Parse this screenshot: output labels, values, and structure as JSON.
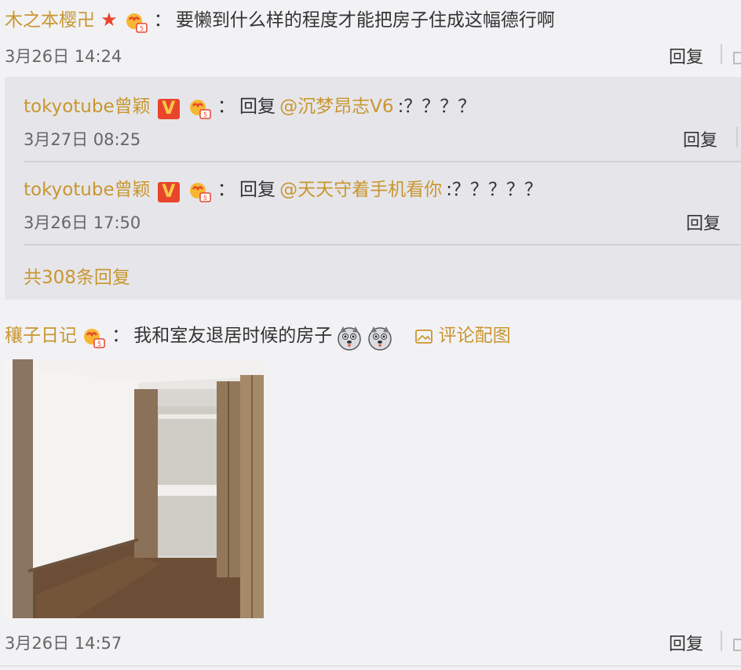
{
  "comment1": {
    "username": "木之本樱卍",
    "separator": "：",
    "text": "要懒到什么样的程度才能把房子住成这幅德行啊",
    "time": "3月26日 14:24",
    "reply_label": "回复"
  },
  "subreplies": [
    {
      "username": "tokyotube曾颖",
      "separator": "：",
      "prefix": "回复",
      "mention": "@沉梦昂志V6",
      "text": ":？？？？",
      "time": "3月27日 08:25",
      "reply_label": "回复"
    },
    {
      "username": "tokyotube曾颖",
      "separator": "：",
      "prefix": "回复",
      "mention": "@天天守着手机看你",
      "text": ":？？？？？",
      "time": "3月26日 17:50",
      "reply_label": "回复"
    }
  ],
  "more_replies": "共308条回复",
  "comment2": {
    "username": "穰子日记",
    "separator": "：",
    "text": "我和室友退居时候的房子",
    "comment_image_label": "评论配图",
    "time": "3月26日 14:57",
    "reply_label": "回复"
  },
  "icons": {
    "star": "star-icon",
    "vip_badge": "V",
    "fan": "fan-badge-icon",
    "emoji": "husky-emoji-icon",
    "image": "image-icon"
  },
  "colors": {
    "username": "#c9962f",
    "badge_red": "#e8452c",
    "subbox_bg": "#e6e6ea",
    "page_bg": "#f2f2f5"
  }
}
